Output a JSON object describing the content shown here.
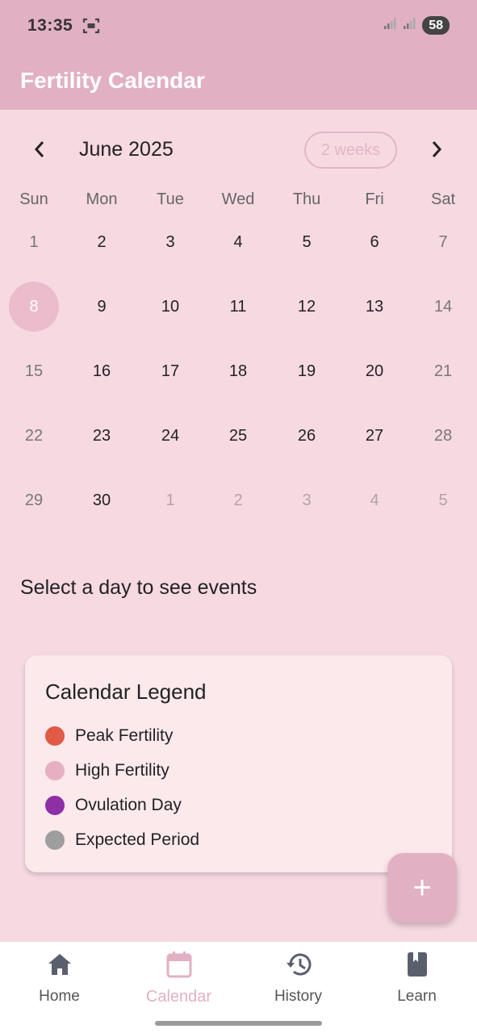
{
  "status_bar": {
    "time": "13:35",
    "battery": "58",
    "icons": [
      "screen-record-icon",
      "signal-icon",
      "signal-icon"
    ]
  },
  "app_bar": {
    "title": "Fertility Calendar"
  },
  "calendar": {
    "month_title": "June 2025",
    "format_button": "2 weeks",
    "prev_icon": "chevron-left-icon",
    "next_icon": "chevron-right-icon",
    "days_of_week": [
      "Sun",
      "Mon",
      "Tue",
      "Wed",
      "Thu",
      "Fri",
      "Sat"
    ],
    "weeks": [
      [
        "1",
        "2",
        "3",
        "4",
        "5",
        "6",
        "7"
      ],
      [
        "8",
        "9",
        "10",
        "11",
        "12",
        "13",
        "14"
      ],
      [
        "15",
        "16",
        "17",
        "18",
        "19",
        "20",
        "21"
      ],
      [
        "22",
        "23",
        "24",
        "25",
        "26",
        "27",
        "28"
      ],
      [
        "29",
        "30",
        "1",
        "2",
        "3",
        "4",
        "5"
      ]
    ],
    "today": "8"
  },
  "events_message": "Select a day to see events",
  "legend": {
    "title": "Calendar Legend",
    "items": [
      {
        "label": "Peak Fertility",
        "color": "#e05a45"
      },
      {
        "label": "High Fertility",
        "color": "#e6afc2"
      },
      {
        "label": "Ovulation Day",
        "color": "#8e2fa6"
      },
      {
        "label": "Expected Period",
        "color": "#9e9e9e"
      }
    ]
  },
  "fab": {
    "label": "+",
    "icon": "plus-icon"
  },
  "bottom_nav": {
    "items": [
      {
        "label": "Home",
        "icon": "home-icon"
      },
      {
        "label": "Calendar",
        "icon": "calendar-icon"
      },
      {
        "label": "History",
        "icon": "history-icon"
      },
      {
        "label": "Learn",
        "icon": "book-icon"
      }
    ],
    "active_index": 1
  },
  "colors": {
    "accent": "#e2b0c3",
    "background": "#f7d9e2",
    "card": "#fbe9ec"
  }
}
